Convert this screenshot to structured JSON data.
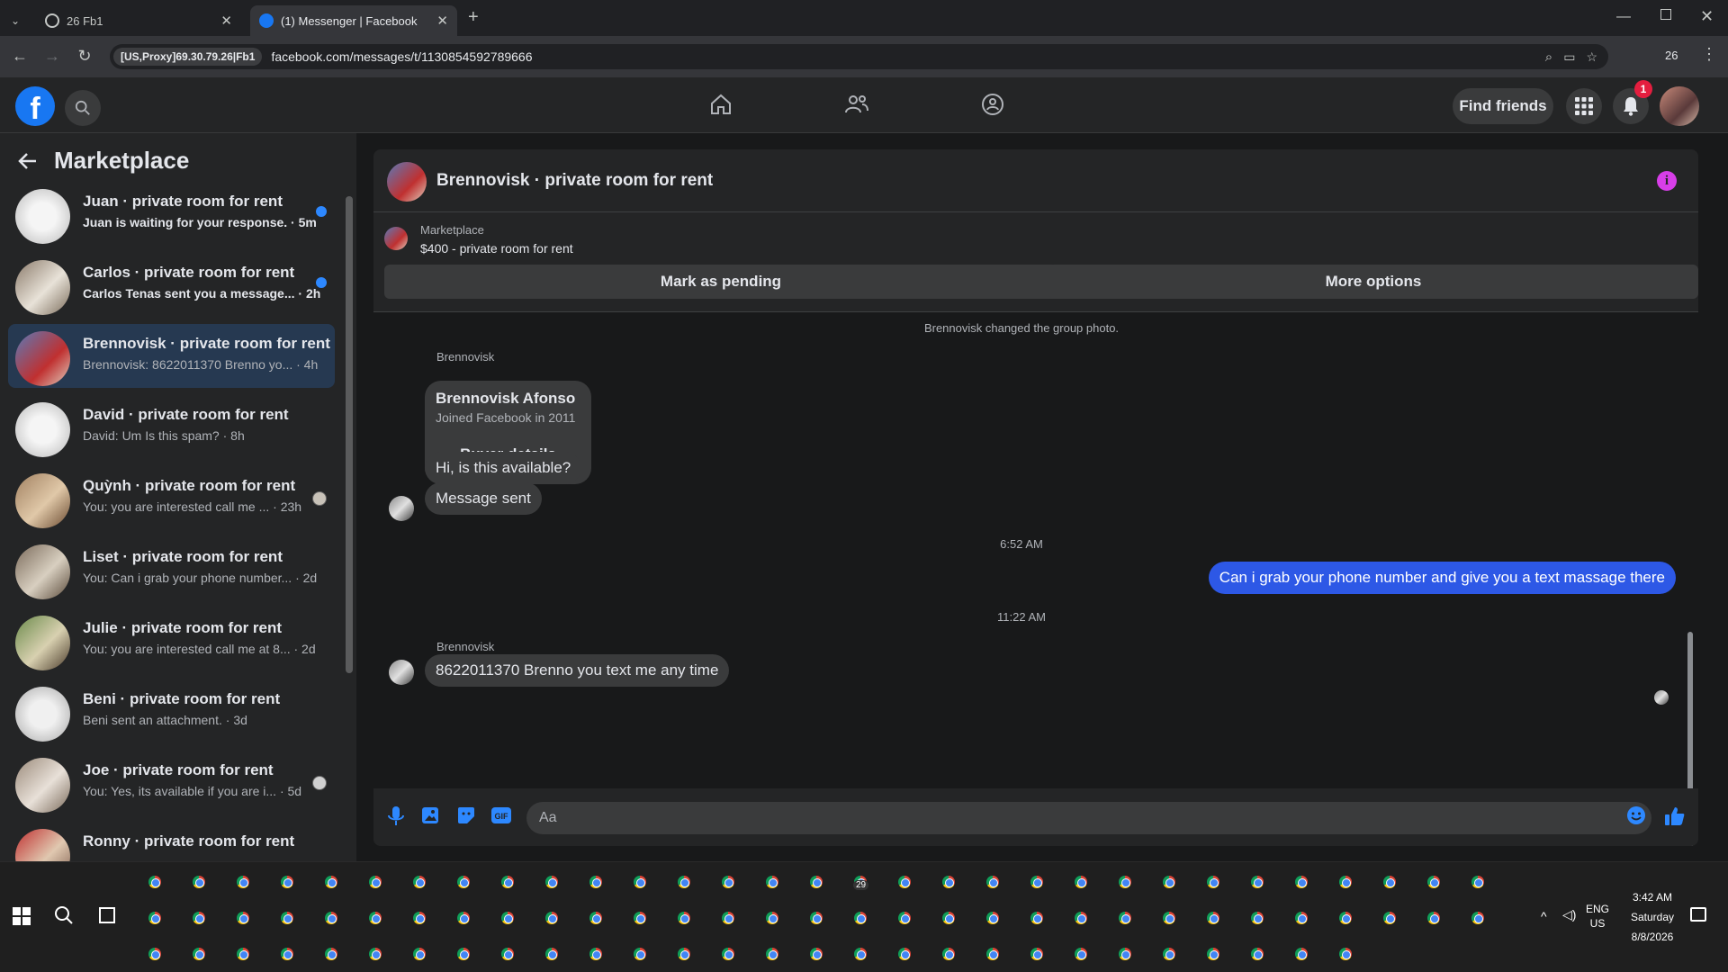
{
  "browser": {
    "tabs": [
      {
        "title": "26 Fb1"
      },
      {
        "title": "(1) Messenger | Facebook"
      }
    ],
    "proxy_label": "[US,Proxy]69.30.79.26|Fb1",
    "url": "facebook.com/messages/t/1130854592789666",
    "profile_num": "26"
  },
  "header": {
    "find_friends": "Find friends",
    "notification_count": "1"
  },
  "sidebar": {
    "title": "Marketplace",
    "conversations": [
      {
        "name": "Juan · private room for rent",
        "preview": "Juan is waiting for your response. · 5m",
        "unread": true
      },
      {
        "name": "Carlos · private room for rent",
        "preview": "Carlos Tenas sent you a message... · 2h",
        "unread": true
      },
      {
        "name": "Brennovisk · private room for rent",
        "preview": "Brennovisk: 8622011370 Brenno yo... · 4h",
        "selected": true
      },
      {
        "name": "David · private room for rent",
        "preview": "David: Um Is this spam? · 8h"
      },
      {
        "name": "Quỳnh · private room for rent",
        "preview": "You: you are interested call me ... · 23h"
      },
      {
        "name": "Liset · private room for rent",
        "preview": "You: Can i grab your phone number... · 2d"
      },
      {
        "name": "Julie · private room for rent",
        "preview": "You: you are interested call me at 8... · 2d"
      },
      {
        "name": "Beni · private room for rent",
        "preview": "Beni sent an attachment. · 3d"
      },
      {
        "name": "Joe · private room for rent",
        "preview": "You: Yes, its available if you are i... · 5d"
      },
      {
        "name": "Ronny · private room for rent",
        "preview": ""
      }
    ]
  },
  "chat": {
    "title": "Brennovisk · private room for rent",
    "listing_source": "Marketplace",
    "listing": "$400 - private room for rent",
    "mark_pending": "Mark as pending",
    "more_options": "More options",
    "system_msg": "Brennovisk changed the group photo.",
    "sender": "Brennovisk",
    "card_name": "Brennovisk Afonso",
    "card_sub": "Joined Facebook in 2011",
    "card_btn": "Buyer details",
    "msg1": "Hi, is this available?",
    "msg2": "Message sent",
    "time1": "6:52 AM",
    "out_msg": "Can i grab your phone number and give  you a text massage there",
    "time2": "11:22 AM",
    "sender2": "Brennovisk",
    "msg3": "8622011370 Brenno you text me any time",
    "input_placeholder": "Aa"
  },
  "taskbar": {
    "time": "3:42 AM",
    "day": "Saturday",
    "date": "8/8/2026",
    "lang1": "ENG",
    "lang2": "US",
    "badge": "29"
  },
  "colors": {
    "accent": "#1877f2",
    "outgoing": "#2d58e6",
    "selected": "#263951",
    "unread_dot": "#2d88ff"
  }
}
